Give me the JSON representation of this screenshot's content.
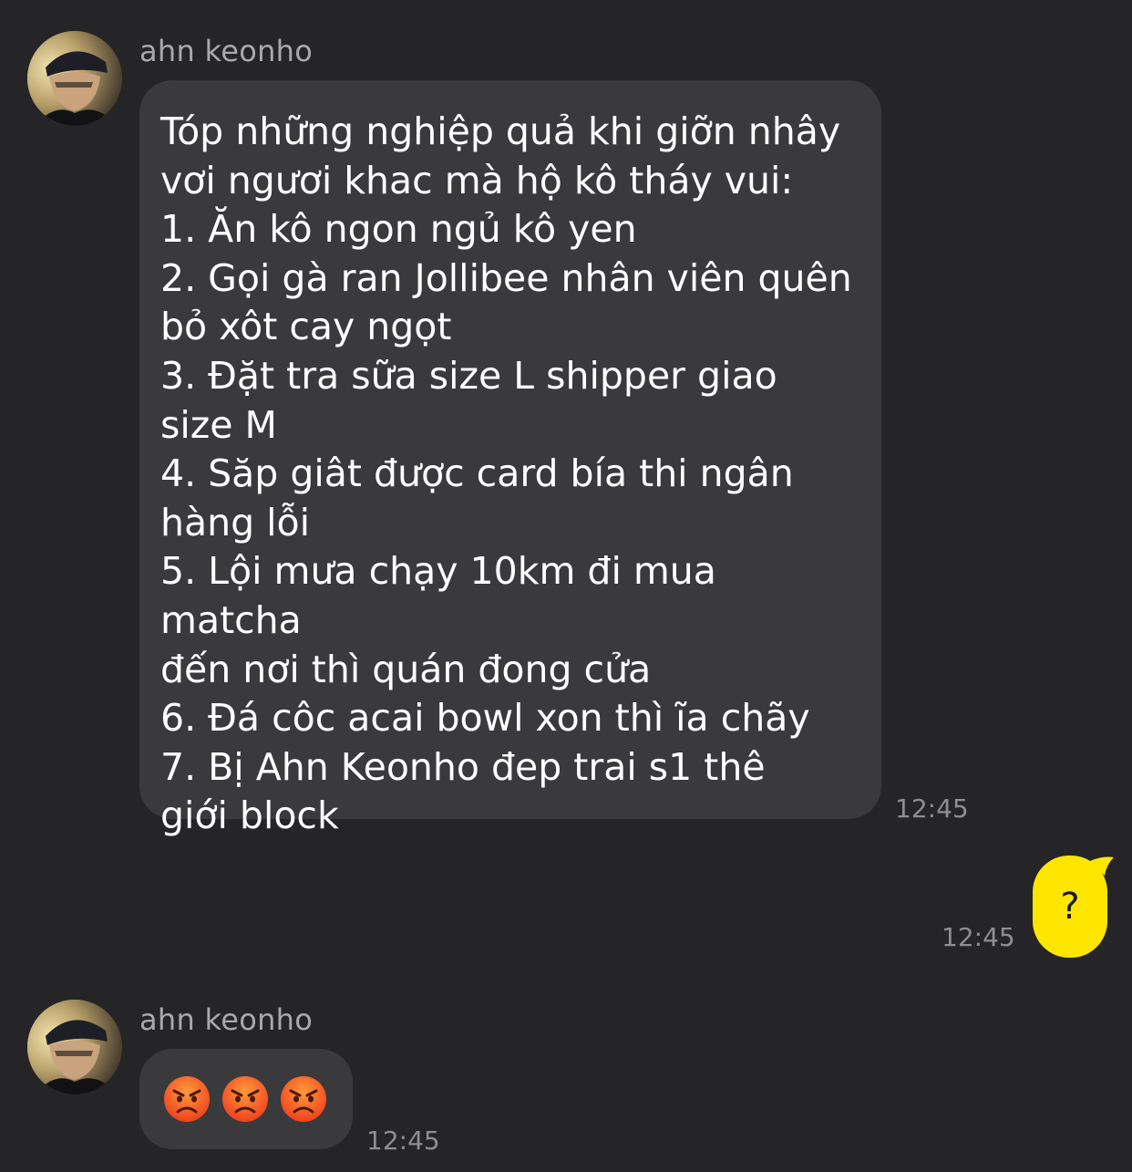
{
  "messages": {
    "first": {
      "sender": "ahn keonho",
      "text": "Tóp những nghiệp quả khi giỡn nhây\nvơi ngươi khac mà hộ kô tháy vui:\n1. Ăn kô ngon ngủ kô yen\n2. Gọi gà ran Jollibee nhân viên quên\nbỏ xôt cay ngọt\n3. Đặt tra sữa size L shipper giao\nsize M\n4. Săp giât được card bía thi ngân\nhàng lỗi\n5. Lội mưa chạy 10km đi mua matcha\nđến nơi thì quán đong cửa\n6. Đá côc acai bowl xon thì ĩa chãy\n7. Bị Ahn Keonho đep trai s1 thê\ngiới block",
      "time": "12:45"
    },
    "reply": {
      "text": "?",
      "time": "12:45"
    },
    "second": {
      "sender": "ahn keonho",
      "emojis": [
        "angry-face-emoji",
        "angry-face-emoji",
        "angry-face-emoji"
      ],
      "time": "12:45"
    }
  },
  "colors": {
    "background": "#252527",
    "incoming_bubble": "#3a3a3d",
    "outgoing_bubble": "#ffe600",
    "sender_name": "#a9a9ad",
    "timestamp": "#8e8e93"
  }
}
